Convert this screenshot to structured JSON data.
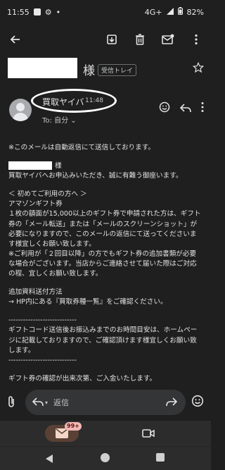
{
  "status_bar": {
    "time": "11:55",
    "network": "4G+",
    "battery": "82%"
  },
  "email": {
    "subject_suffix": "様",
    "label": "受信トレイ",
    "sender_name": "買取ヤイバ",
    "time": "11:48",
    "to_line": "To: 自分",
    "body": {
      "intro": "※このメールは自動返信にて送信しております。",
      "salutation_suffix": "様",
      "thanks": "買取ヤイバへお申込みいただき、誠に有難う御座います。",
      "first_time_heading": "＜ 初めてご利用の方へ ＞",
      "giftcard_heading": "アマゾンギフト券",
      "giftcard_text": "１枚の額面が15,000以上のギフト券で申請された方は、ギフト券の「メール転送」または「メールのスクリーンショット」が必要になりますので、このメールの返信にて送ってくださいます様宜しくお願い致します。",
      "second_time_text": "※ご利用が「２回目以降」の方でもギフト券の追加書類が必要な場合がございます。当店からご連絡させて届いた際はご対応の程、宜しくお願い致します。",
      "additional_docs_heading": "追加資料送付方法",
      "additional_docs_text": "→ HP内にある『買取券種一覧』をご確認ください。",
      "separator_1": "----------------------------",
      "payment_time_text": "ギフトコード送信後お振込みまでのお時間目安は、ホームページに記載しておりますので、ご確認頂けます様宜しくお願い致します。",
      "separator_2": "----------------------------",
      "confirmation_text": "ギフト券の確認が出来次第、ご入金いたします。"
    }
  },
  "reply": {
    "placeholder": "返信"
  },
  "bottom_nav": {
    "mail_badge": "99+"
  },
  "colors": {
    "background": "#1f1f1f",
    "text": "#e3e3e3",
    "badge": "#f2b8b5"
  }
}
